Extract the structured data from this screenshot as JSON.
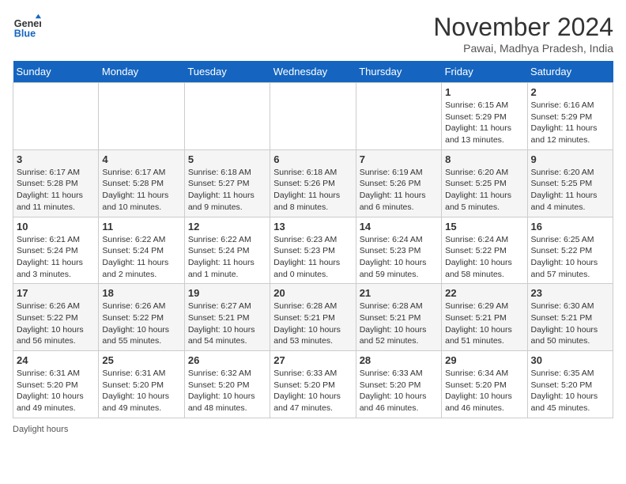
{
  "header": {
    "logo_line1": "General",
    "logo_line2": "Blue",
    "month": "November 2024",
    "location": "Pawai, Madhya Pradesh, India"
  },
  "days_of_week": [
    "Sunday",
    "Monday",
    "Tuesday",
    "Wednesday",
    "Thursday",
    "Friday",
    "Saturday"
  ],
  "weeks": [
    [
      {
        "num": "",
        "info": ""
      },
      {
        "num": "",
        "info": ""
      },
      {
        "num": "",
        "info": ""
      },
      {
        "num": "",
        "info": ""
      },
      {
        "num": "",
        "info": ""
      },
      {
        "num": "1",
        "info": "Sunrise: 6:15 AM\nSunset: 5:29 PM\nDaylight: 11 hours and 13 minutes."
      },
      {
        "num": "2",
        "info": "Sunrise: 6:16 AM\nSunset: 5:29 PM\nDaylight: 11 hours and 12 minutes."
      }
    ],
    [
      {
        "num": "3",
        "info": "Sunrise: 6:17 AM\nSunset: 5:28 PM\nDaylight: 11 hours and 11 minutes."
      },
      {
        "num": "4",
        "info": "Sunrise: 6:17 AM\nSunset: 5:28 PM\nDaylight: 11 hours and 10 minutes."
      },
      {
        "num": "5",
        "info": "Sunrise: 6:18 AM\nSunset: 5:27 PM\nDaylight: 11 hours and 9 minutes."
      },
      {
        "num": "6",
        "info": "Sunrise: 6:18 AM\nSunset: 5:26 PM\nDaylight: 11 hours and 8 minutes."
      },
      {
        "num": "7",
        "info": "Sunrise: 6:19 AM\nSunset: 5:26 PM\nDaylight: 11 hours and 6 minutes."
      },
      {
        "num": "8",
        "info": "Sunrise: 6:20 AM\nSunset: 5:25 PM\nDaylight: 11 hours and 5 minutes."
      },
      {
        "num": "9",
        "info": "Sunrise: 6:20 AM\nSunset: 5:25 PM\nDaylight: 11 hours and 4 minutes."
      }
    ],
    [
      {
        "num": "10",
        "info": "Sunrise: 6:21 AM\nSunset: 5:24 PM\nDaylight: 11 hours and 3 minutes."
      },
      {
        "num": "11",
        "info": "Sunrise: 6:22 AM\nSunset: 5:24 PM\nDaylight: 11 hours and 2 minutes."
      },
      {
        "num": "12",
        "info": "Sunrise: 6:22 AM\nSunset: 5:24 PM\nDaylight: 11 hours and 1 minute."
      },
      {
        "num": "13",
        "info": "Sunrise: 6:23 AM\nSunset: 5:23 PM\nDaylight: 11 hours and 0 minutes."
      },
      {
        "num": "14",
        "info": "Sunrise: 6:24 AM\nSunset: 5:23 PM\nDaylight: 10 hours and 59 minutes."
      },
      {
        "num": "15",
        "info": "Sunrise: 6:24 AM\nSunset: 5:22 PM\nDaylight: 10 hours and 58 minutes."
      },
      {
        "num": "16",
        "info": "Sunrise: 6:25 AM\nSunset: 5:22 PM\nDaylight: 10 hours and 57 minutes."
      }
    ],
    [
      {
        "num": "17",
        "info": "Sunrise: 6:26 AM\nSunset: 5:22 PM\nDaylight: 10 hours and 56 minutes."
      },
      {
        "num": "18",
        "info": "Sunrise: 6:26 AM\nSunset: 5:22 PM\nDaylight: 10 hours and 55 minutes."
      },
      {
        "num": "19",
        "info": "Sunrise: 6:27 AM\nSunset: 5:21 PM\nDaylight: 10 hours and 54 minutes."
      },
      {
        "num": "20",
        "info": "Sunrise: 6:28 AM\nSunset: 5:21 PM\nDaylight: 10 hours and 53 minutes."
      },
      {
        "num": "21",
        "info": "Sunrise: 6:28 AM\nSunset: 5:21 PM\nDaylight: 10 hours and 52 minutes."
      },
      {
        "num": "22",
        "info": "Sunrise: 6:29 AM\nSunset: 5:21 PM\nDaylight: 10 hours and 51 minutes."
      },
      {
        "num": "23",
        "info": "Sunrise: 6:30 AM\nSunset: 5:21 PM\nDaylight: 10 hours and 50 minutes."
      }
    ],
    [
      {
        "num": "24",
        "info": "Sunrise: 6:31 AM\nSunset: 5:20 PM\nDaylight: 10 hours and 49 minutes."
      },
      {
        "num": "25",
        "info": "Sunrise: 6:31 AM\nSunset: 5:20 PM\nDaylight: 10 hours and 49 minutes."
      },
      {
        "num": "26",
        "info": "Sunrise: 6:32 AM\nSunset: 5:20 PM\nDaylight: 10 hours and 48 minutes."
      },
      {
        "num": "27",
        "info": "Sunrise: 6:33 AM\nSunset: 5:20 PM\nDaylight: 10 hours and 47 minutes."
      },
      {
        "num": "28",
        "info": "Sunrise: 6:33 AM\nSunset: 5:20 PM\nDaylight: 10 hours and 46 minutes."
      },
      {
        "num": "29",
        "info": "Sunrise: 6:34 AM\nSunset: 5:20 PM\nDaylight: 10 hours and 46 minutes."
      },
      {
        "num": "30",
        "info": "Sunrise: 6:35 AM\nSunset: 5:20 PM\nDaylight: 10 hours and 45 minutes."
      }
    ]
  ],
  "footer": "Daylight hours"
}
